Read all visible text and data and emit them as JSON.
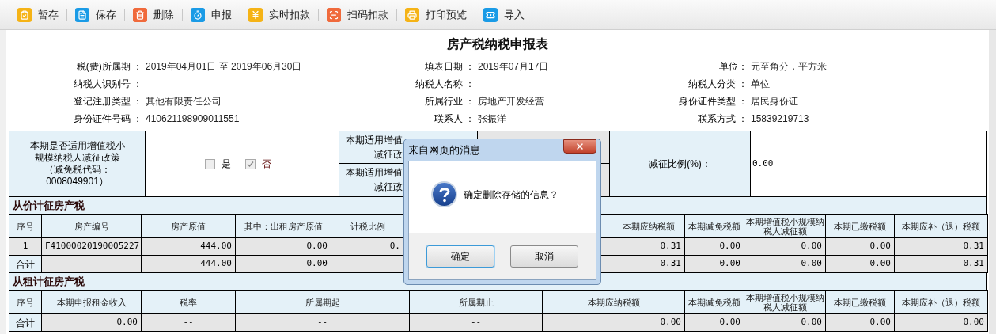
{
  "toolbar": [
    {
      "label": "暂存",
      "color": "#f5b316"
    },
    {
      "label": "保存",
      "color": "#1a9be6"
    },
    {
      "label": "删除",
      "color": "#f06a3c"
    },
    {
      "label": "申报",
      "color": "#1a9be6"
    },
    {
      "label": "实时扣款",
      "color": "#f5b316"
    },
    {
      "label": "扫码扣款",
      "color": "#f06a3c"
    },
    {
      "label": "打印预览",
      "color": "#f5b316"
    },
    {
      "label": "导入",
      "color": "#1a9be6"
    }
  ],
  "form": {
    "title": "房产税纳税申报表",
    "fields": [
      {
        "label": "税(费)所属期 ：",
        "value": "2019年04月01日 至 2019年06月30日"
      },
      {
        "label": "填表日期 ：",
        "value": "2019年07月17日"
      },
      {
        "label": "单位：",
        "value": "元至角分，平方米"
      },
      {
        "label": "纳税人识别号 ："
      },
      {
        "label": "纳税人名称 ："
      },
      {
        "label": "纳税人分类 ：",
        "value": "单位"
      },
      {
        "label": "登记注册类型 ：",
        "value": "其他有限责任公司"
      },
      {
        "label": "所属行业 ：",
        "value": "房地产开发经营"
      },
      {
        "label": "身份证件类型 ：",
        "value": "居民身份证"
      },
      {
        "label": "身份证件号码 ：",
        "value": "410621198909011551"
      },
      {
        "label": "联系人 ：",
        "value": "张振洋"
      },
      {
        "label": "联系方式 ：",
        "value": "15839219713"
      }
    ]
  },
  "policy": {
    "question": "本期是否适用增值税小规模纳税人减征政策（减免税代码：0008049901）",
    "options": [
      {
        "label": "是",
        "checked": false
      },
      {
        "label": "否",
        "checked": true
      }
    ],
    "rows": [
      {
        "line_1": "本期适用增值",
        "line_2": "减征政"
      },
      {
        "line_1": "本期适用增值",
        "line_2": "减征政"
      }
    ],
    "ratio_label": "减征比例(%)：",
    "ratio_value": "0.00"
  },
  "value_section": {
    "title": "从价计征房产税",
    "columns": [
      "序号",
      "房产编号",
      "房产原值",
      "其中：出租房产原值",
      "计税比例",
      "本期应纳税额",
      "本期减免税额",
      "本期增值税小规模纳税人减征额",
      "本期已缴税额",
      "本期应补（退）税额"
    ],
    "rows": [
      {
        "cells": [
          "1",
          "F41000020190005227",
          "444.00",
          "0.00",
          "0.",
          "0.31",
          "0.00",
          "0.00",
          "0.00",
          "0.31"
        ]
      },
      {
        "cells": [
          "合计",
          "--",
          "444.00",
          "0.00",
          "--",
          "0.31",
          "0.00",
          "0.00",
          "0.00",
          "0.31"
        ]
      }
    ]
  },
  "rent_section": {
    "title": "从租计征房产税",
    "columns": [
      "序号",
      "本期申报租金收入",
      "税率",
      "所属期起",
      "所属期止",
      "本期应纳税额",
      "本期减免税额",
      "本期增值税小规模纳税人减征额",
      "本期已缴税额",
      "本期应补（退）税额"
    ],
    "rows": [
      {
        "cells": [
          "合计",
          "0.00",
          "--",
          "--",
          "--",
          "0.00",
          "0.00",
          "0.00",
          "0.00",
          "0.00"
        ]
      }
    ]
  },
  "dialog": {
    "title": "来自网页的消息",
    "message": "确定删除存储的信息？",
    "buttons": [
      {
        "label": "确定",
        "focused": true
      },
      {
        "label": "取消",
        "focused": false
      }
    ]
  }
}
